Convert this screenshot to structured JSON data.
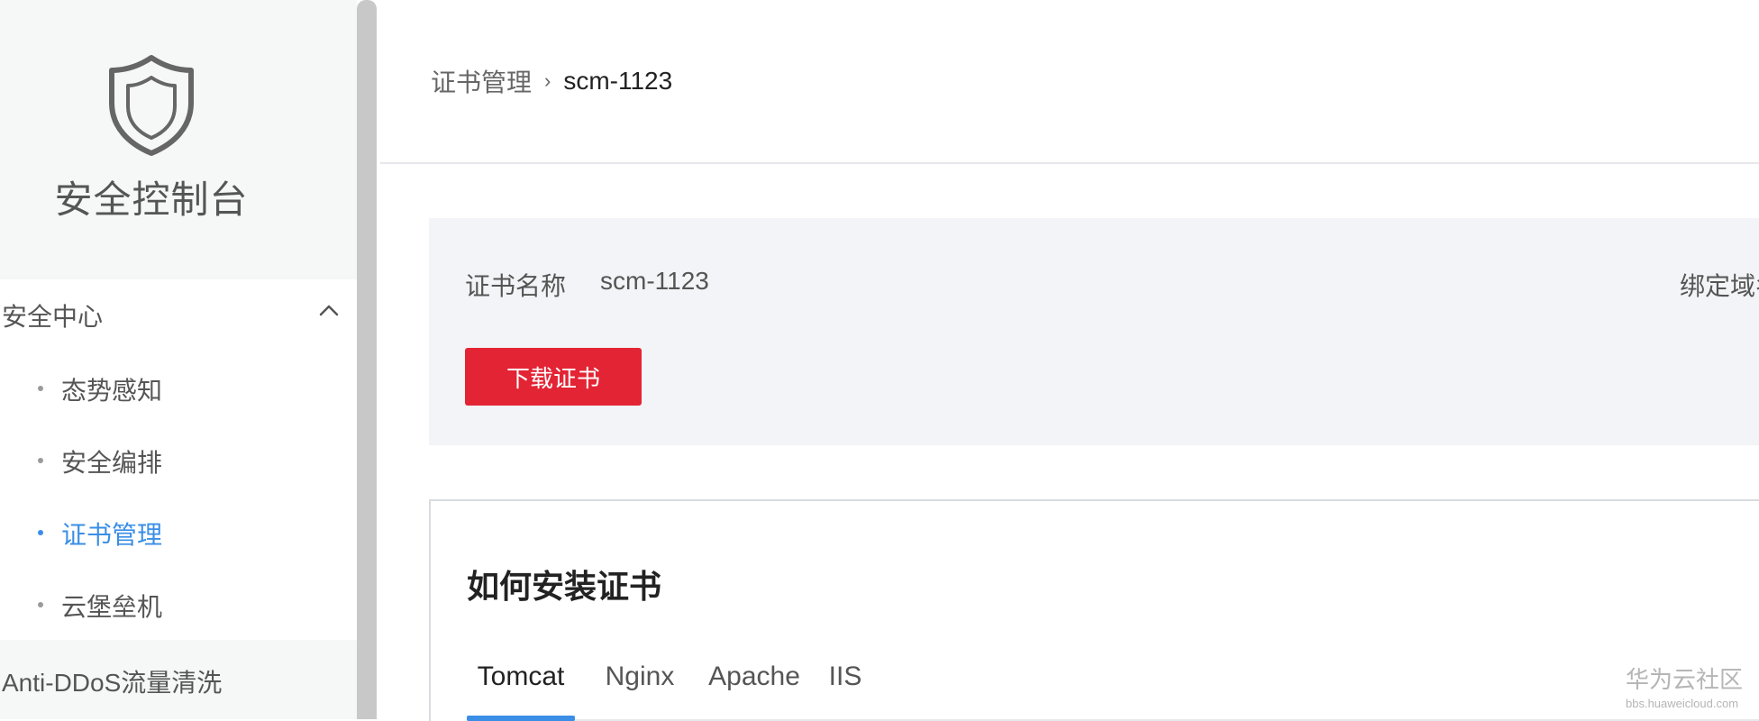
{
  "sidebar": {
    "brand_title": "安全控制台",
    "brand_icon": "shield-icon",
    "groups": [
      {
        "label": "安全中心",
        "expanded_icon": "chevron-up-icon",
        "items": [
          {
            "label": "态势感知",
            "active": false
          },
          {
            "label": "安全编排",
            "active": false
          },
          {
            "label": "证书管理",
            "active": true
          },
          {
            "label": "云堡垒机",
            "active": false
          }
        ]
      },
      {
        "label": "Anti-DDoS流量清洗"
      }
    ]
  },
  "breadcrumb": {
    "parent": "证书管理",
    "current": "scm-1123"
  },
  "cert_info": {
    "name_label": "证书名称",
    "name_value": "scm-1123",
    "domain_label": "绑定域名",
    "download_label": "下载证书"
  },
  "install": {
    "title": "如何安装证书",
    "tabs": [
      "Tomcat",
      "Nginx",
      "Apache",
      "IIS"
    ],
    "active_tab": "Tomcat"
  },
  "watermark": {
    "line1": "华为云社区",
    "line2": "bbs.huaweicloud.com"
  },
  "colors": {
    "accent": "#3a8ee6",
    "danger_button": "#e32434",
    "sidebar_bg": "#f6f7f7",
    "card_bg": "#f3f4f7"
  }
}
